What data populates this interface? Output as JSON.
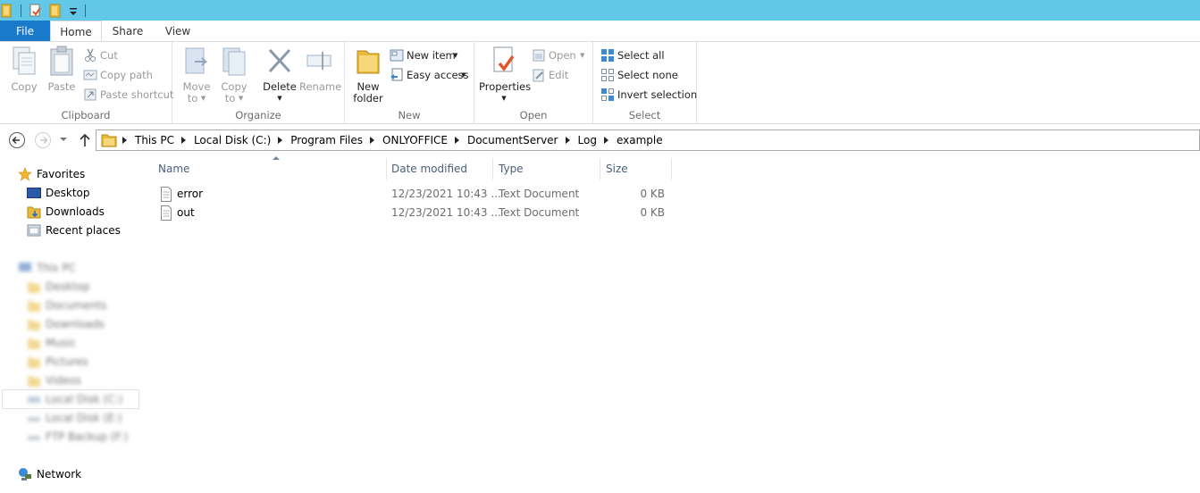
{
  "tabs": {
    "file": "File",
    "home": "Home",
    "share": "Share",
    "view": "View"
  },
  "ribbon": {
    "clipboard": {
      "label": "Clipboard",
      "copy": "Copy",
      "paste": "Paste",
      "cut": "Cut",
      "copy_path": "Copy path",
      "paste_shortcut": "Paste shortcut"
    },
    "organize": {
      "label": "Organize",
      "move_to": [
        "Move",
        "to"
      ],
      "copy_to": [
        "Copy",
        "to"
      ],
      "delete": "Delete",
      "rename": "Rename"
    },
    "new": {
      "label": "New",
      "new_folder": [
        "New",
        "folder"
      ],
      "new_item": "New item",
      "easy_access": "Easy access"
    },
    "open": {
      "label": "Open",
      "properties": "Properties",
      "open": "Open",
      "edit": "Edit"
    },
    "select": {
      "label": "Select",
      "select_all": "Select all",
      "select_none": "Select none",
      "invert_selection": "Invert selection"
    }
  },
  "address": {
    "crumbs": [
      "This PC",
      "Local Disk (C:)",
      "Program Files",
      "ONLYOFFICE",
      "DocumentServer",
      "Log",
      "example"
    ]
  },
  "navpane": {
    "favorites": "Favorites",
    "desktop": "Desktop",
    "downloads": "Downloads",
    "recent_places": "Recent places",
    "network": "Network",
    "blurred": {
      "this_pc": "This PC",
      "desktop": "Desktop",
      "documents": "Documents",
      "downloads": "Downloads",
      "music": "Music",
      "pictures": "Pictures",
      "videos": "Videos",
      "local_c": "Local Disk (C:)",
      "local_e": "Local Disk (E:)",
      "ftp_backup": "FTP Backup (F:)"
    }
  },
  "columns": {
    "name": "Name",
    "date_modified": "Date modified",
    "type": "Type",
    "size": "Size"
  },
  "files": [
    {
      "name": "error",
      "date": "12/23/2021 10:43 ...",
      "type": "Text Document",
      "size": "0 KB"
    },
    {
      "name": "out",
      "date": "12/23/2021 10:43 ...",
      "type": "Text Document",
      "size": "0 KB"
    }
  ]
}
